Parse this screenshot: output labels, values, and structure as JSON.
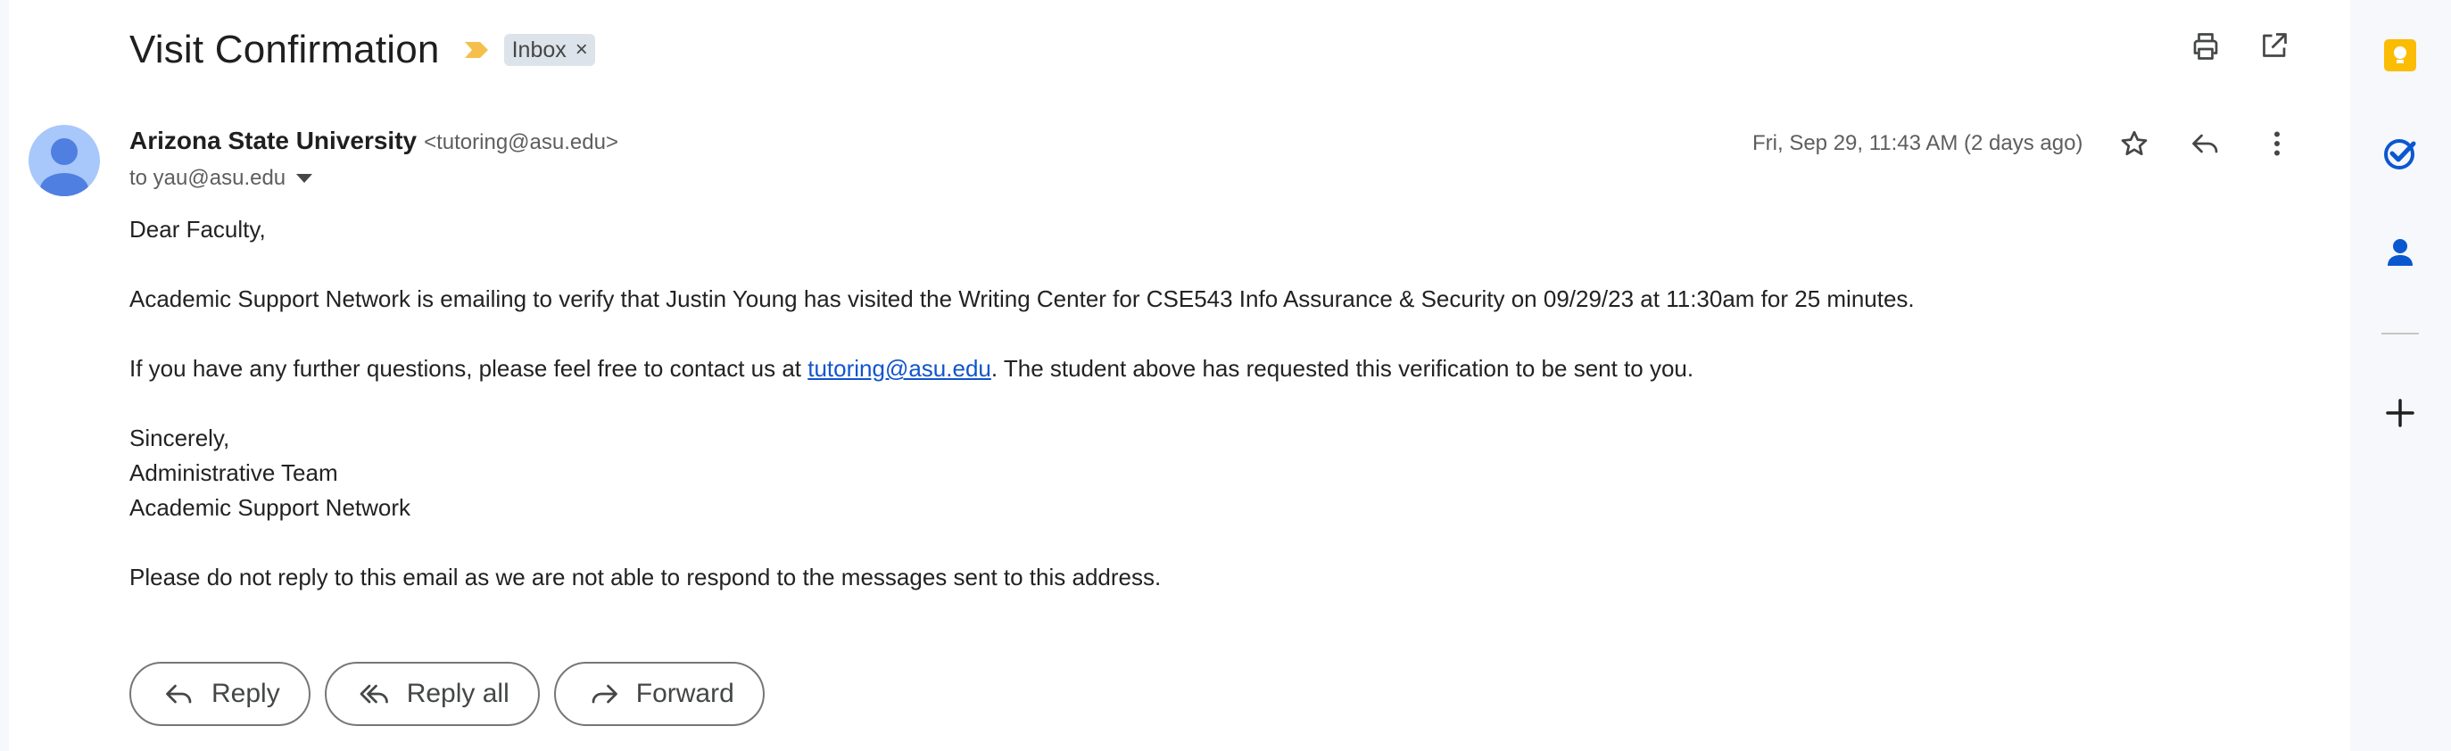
{
  "subject": {
    "title": "Visit Confirmation",
    "label": "Inbox",
    "label_remove": "×"
  },
  "toolbar": {
    "print_icon": "print-icon",
    "open_new_window_icon": "open-in-new-window-icon"
  },
  "message": {
    "sender_name": "Arizona State University",
    "sender_email": "<tutoring@asu.edu>",
    "to_line": "to yau@asu.edu",
    "date": "Fri, Sep 29, 11:43 AM (2 days ago)",
    "body": {
      "greeting": "Dear Faculty,",
      "para1": "Academic Support Network is emailing to verify that Justin Young has visited the Writing Center for CSE543 Info Assurance & Security on 09/29/23 at 11:30am for 25 minutes.",
      "para2_prefix": "If you have any further questions, please feel free to contact us at ",
      "para2_link": "tutoring@asu.edu",
      "para2_suffix": ". The student above has requested this verification to be sent to you.",
      "closing": "Sincerely,",
      "signature_line1": "Administrative Team",
      "signature_line2": "Academic Support Network",
      "footer_note": "Please do not reply to this email as we are not able to respond to the messages sent to this address."
    }
  },
  "actions": {
    "reply": "Reply",
    "reply_all": "Reply all",
    "forward": "Forward"
  },
  "colors": {
    "keep_yellow": "#fbbc04",
    "tasks_blue": "#0b57d0",
    "link_blue": "#1155cc",
    "importance_marker": "#f4c04b",
    "avatar_bg": "#a8c7fa",
    "avatar_fg": "#4f7fe0"
  },
  "side_panel": {
    "keep_icon": "keep-icon",
    "tasks_icon": "tasks-icon",
    "contacts_icon": "contacts-icon",
    "add_icon": "add-icon"
  }
}
